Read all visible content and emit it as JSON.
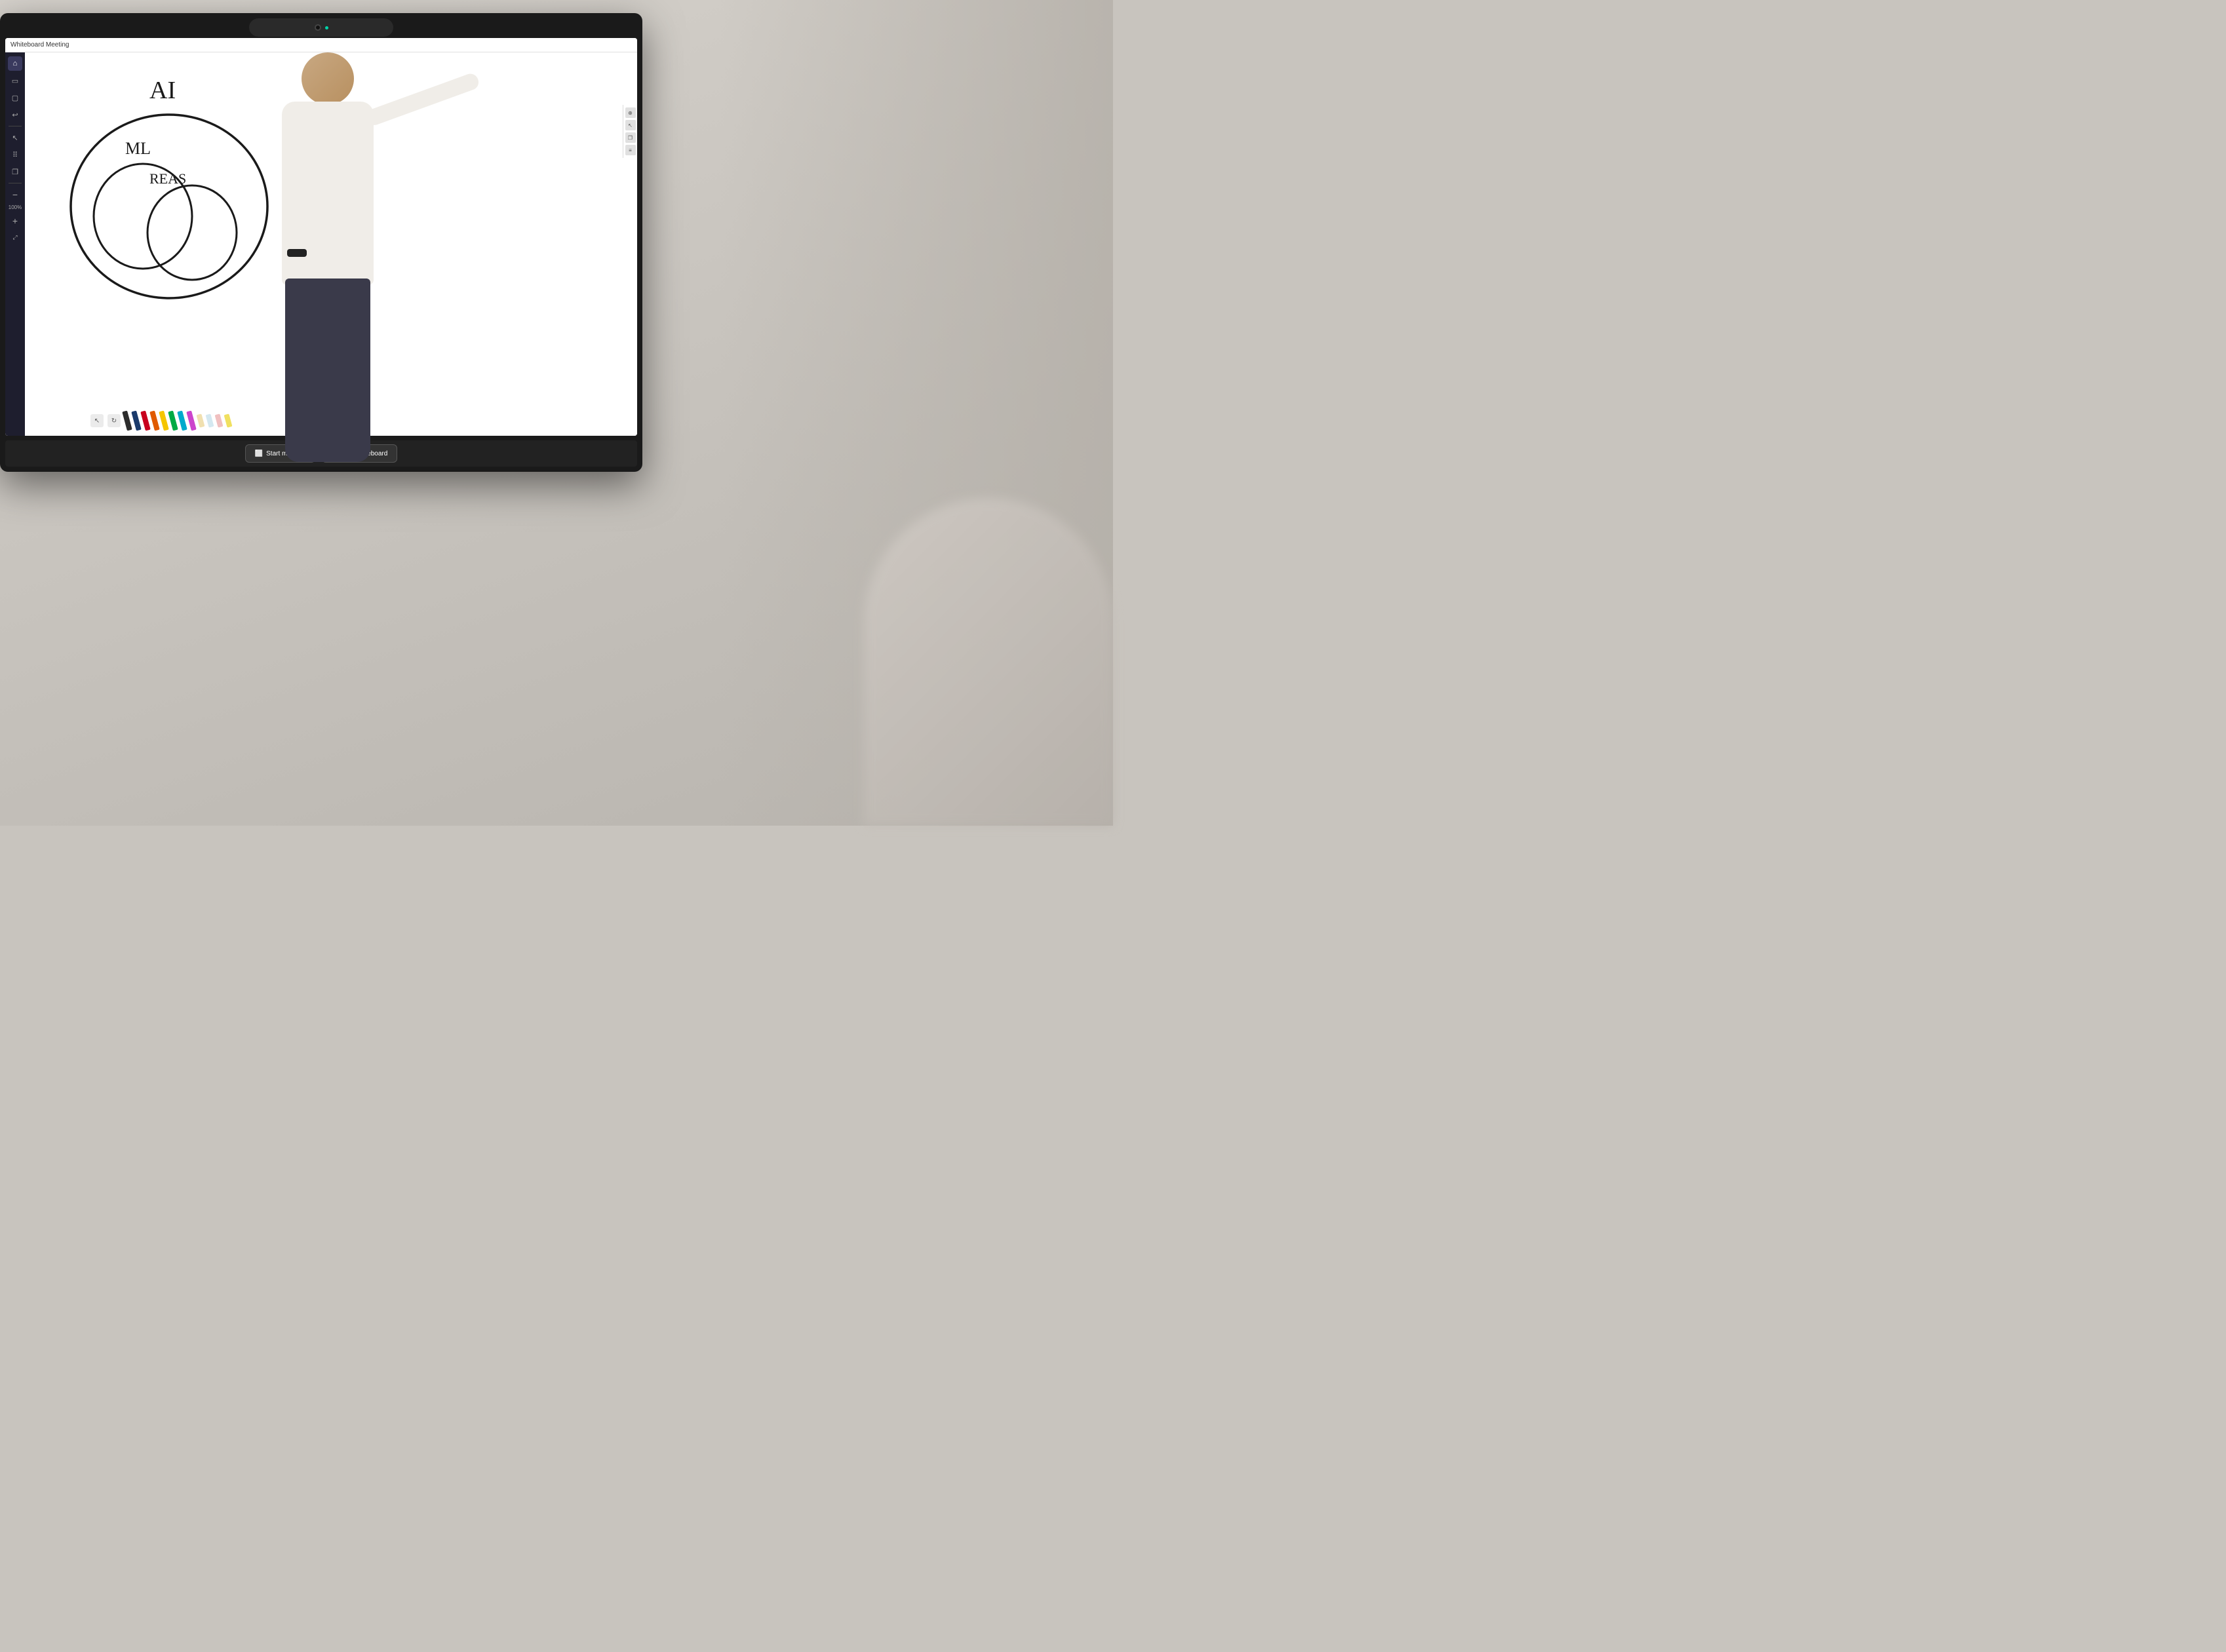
{
  "app": {
    "title": "Whiteboard Meeting"
  },
  "titlebar": {
    "label": "Whiteboard Meeting"
  },
  "sidebar": {
    "icons": [
      {
        "name": "home",
        "symbol": "⌂",
        "active": true
      },
      {
        "name": "screen",
        "symbol": "▭",
        "active": false
      },
      {
        "name": "monitor",
        "symbol": "▢",
        "active": false
      },
      {
        "name": "import",
        "symbol": "↩",
        "active": false
      },
      {
        "name": "cursor",
        "symbol": "↖",
        "active": false
      },
      {
        "name": "grid",
        "symbol": "⠿",
        "active": false
      },
      {
        "name": "layers",
        "symbol": "❐",
        "active": false
      }
    ],
    "zoom": "100%"
  },
  "drawing": {
    "text_ai": "AI",
    "text_ml": "ML",
    "text_reas": "REAS"
  },
  "bottom_buttons": [
    {
      "id": "start-meeting",
      "label": "Start meeting",
      "icon": "⬜"
    },
    {
      "id": "stop-whiteboard",
      "label": "Stop whiteboard",
      "icon": "✕"
    }
  ],
  "markers": [
    {
      "color": "#2c2c2c"
    },
    {
      "color": "#1a3a6b"
    },
    {
      "color": "#c8001e"
    },
    {
      "color": "#e05a00"
    },
    {
      "color": "#f5c500"
    },
    {
      "color": "#00aa44"
    },
    {
      "color": "#00aacc"
    },
    {
      "color": "#cc44cc"
    },
    {
      "color": "#f0e0b0"
    },
    {
      "color": "#d4e8f0"
    },
    {
      "color": "#f0c0c0"
    },
    {
      "color": "#f0e060"
    }
  ],
  "zoom_level": "100%",
  "colors": {
    "sidebar_bg": "#1e1e2e",
    "screen_bg": "#ffffff",
    "button_border": "#555555",
    "button_bg": "#333333",
    "accent": "#00d4aa"
  }
}
